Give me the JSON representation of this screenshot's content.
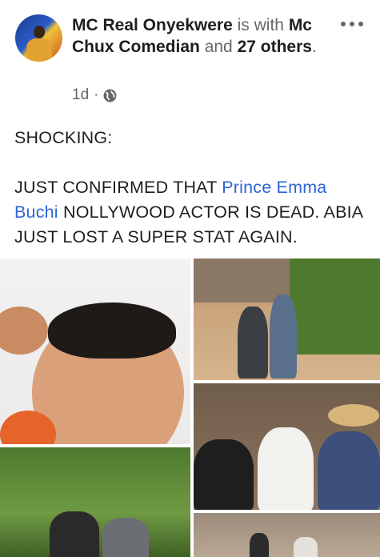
{
  "post": {
    "author_name": "MC Real Onyekwere",
    "with_word": "is with",
    "tagged_name": "Mc Chux Comedian",
    "and_word": "and",
    "others": "27 others",
    "period": ".",
    "time": "1d",
    "separator": "·",
    "privacy_icon": "globe-icon",
    "more_icon": "more-options-icon"
  },
  "body": {
    "line1": "SHOCKING:",
    "line2_prefix": "JUST CONFIRMED THAT ",
    "mention": "Prince Emma Buchi",
    "line2_suffix": " NOLLYWOOD ACTOR IS DEAD. ABIA JUST LOST A SUPER STAT AGAIN."
  },
  "colors": {
    "link": "#2f64d6",
    "muted": "#65676b",
    "text": "#1c1e21"
  },
  "photos": [
    {
      "name": "selfie-photo"
    },
    {
      "name": "road-photo"
    },
    {
      "name": "group-photo"
    },
    {
      "name": "forest-photo"
    },
    {
      "name": "street-photo"
    }
  ]
}
